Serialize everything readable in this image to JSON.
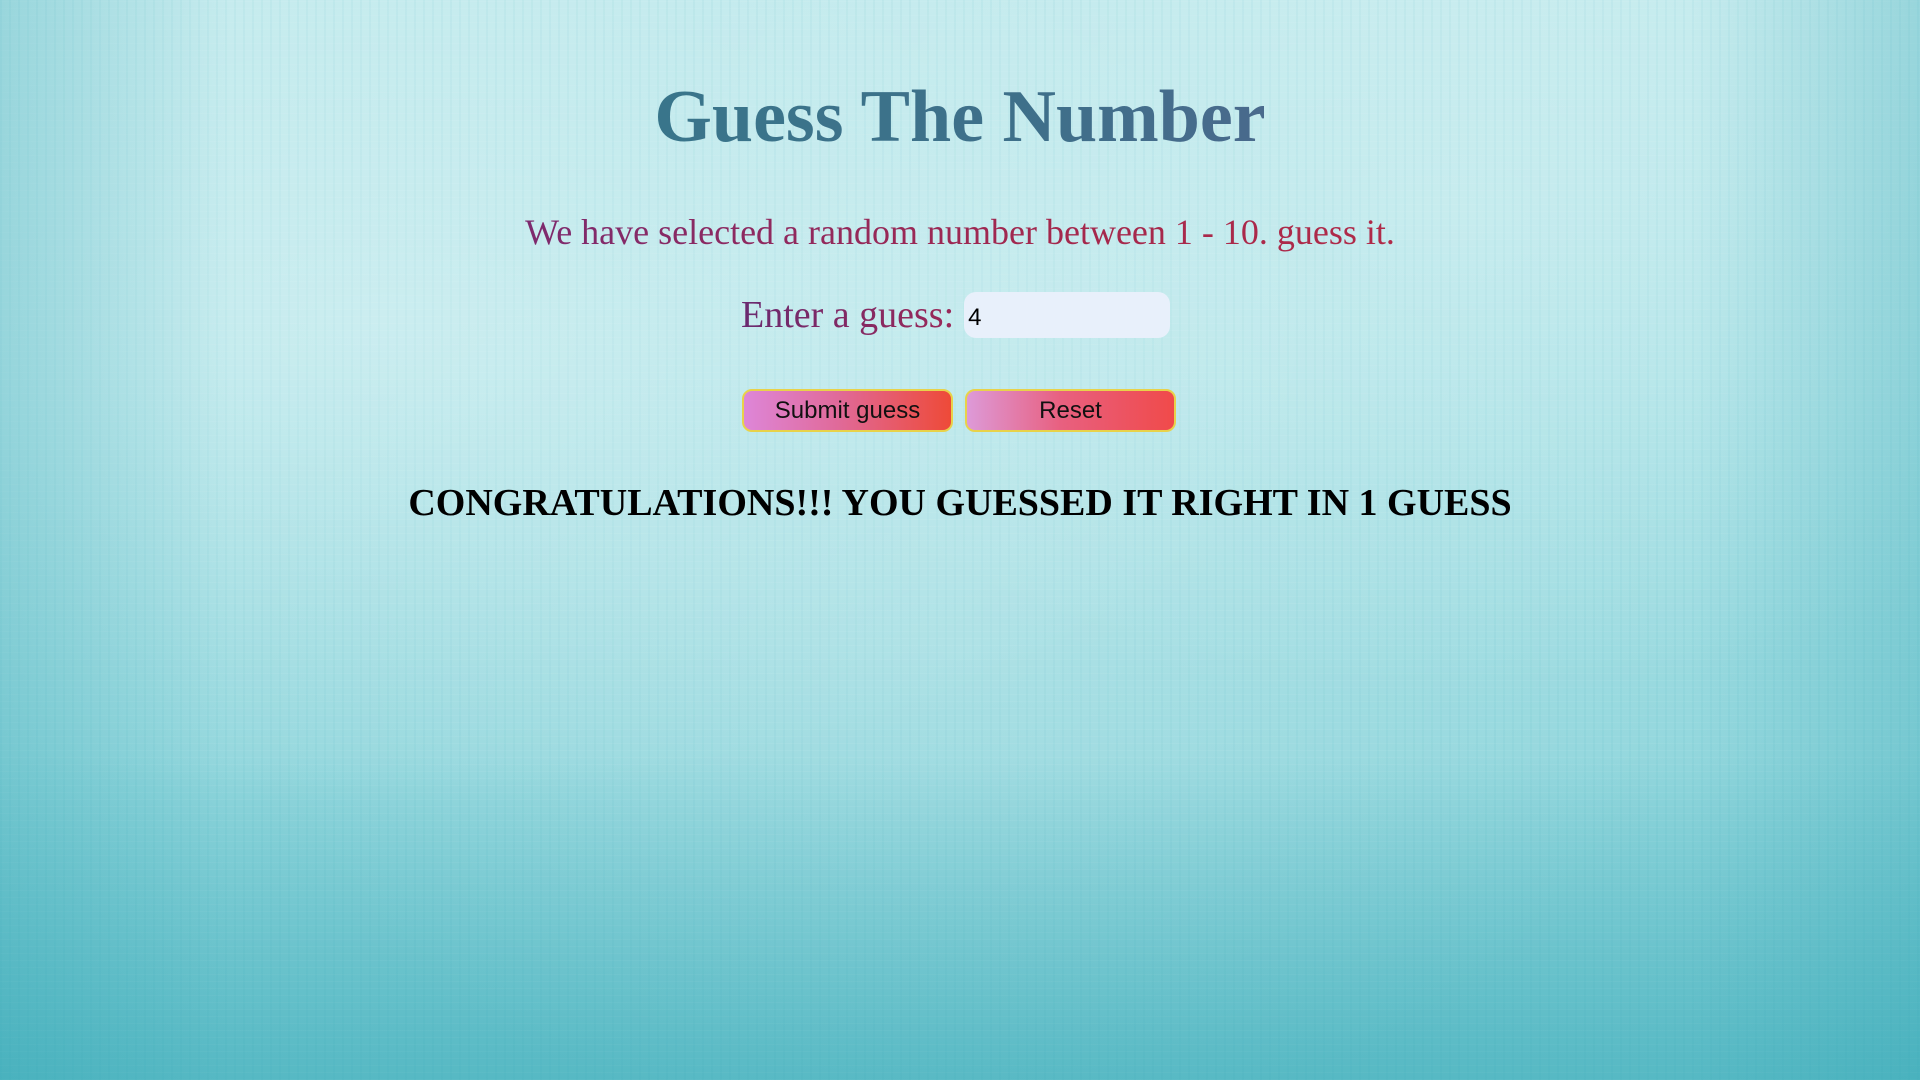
{
  "page": {
    "title": "Guess The Number",
    "intro": "We have selected a random number between 1 - 10. guess it."
  },
  "form": {
    "label": "Enter a guess:",
    "input_value": "4",
    "submit_label": "Submit guess",
    "reset_label": "Reset"
  },
  "result": {
    "message": "CONGRATULATIONS!!! YOU GUESSED IT RIGHT IN 1 GUESS"
  },
  "colors": {
    "title_gradient_start": "#2f7f8c",
    "title_gradient_end": "#6a5a95",
    "intro_text": "#8a2a6a",
    "input_background": "#e8f0fb",
    "button_border": "#e8d24a",
    "button_gradient_start": "#de86d8",
    "button_gradient_end": "#ee4a38",
    "background_teal": "#93d7dd"
  }
}
